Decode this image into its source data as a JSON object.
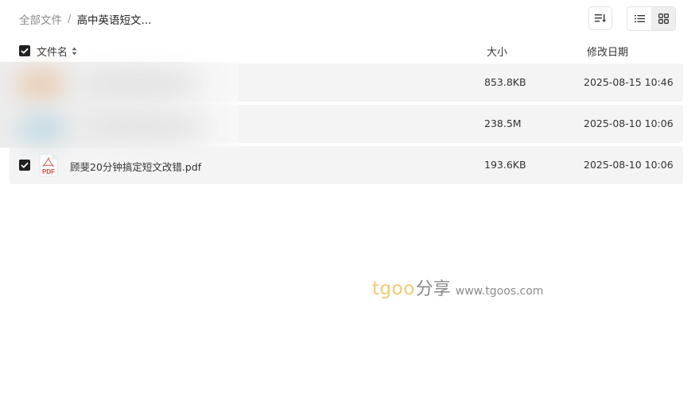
{
  "breadcrumb": {
    "root": "全部文件",
    "separator": "/",
    "current": "高中英语短文..."
  },
  "toolbar": {
    "sort_icon": "sort-list-icon",
    "view_list_icon": "list-view-icon",
    "view_grid_icon": "grid-view-icon",
    "active_view": "list"
  },
  "table": {
    "header": {
      "name": "文件名",
      "size": "大小",
      "date": "修改日期",
      "select_all_checked": true
    },
    "rows": [
      {
        "name": "",
        "size": "853.8KB",
        "date": "2025-08-15 10:46",
        "checked": false,
        "blurred": true
      },
      {
        "name": "",
        "size": "238.5M",
        "date": "2025-08-10 10:06",
        "checked": false,
        "blurred": true
      },
      {
        "name": "顾斐20分钟搞定短文改错.pdf",
        "size": "193.6KB",
        "date": "2025-08-10 10:06",
        "checked": true,
        "icon": "pdf-file-icon",
        "icon_label": "PDF"
      }
    ]
  },
  "watermark": {
    "brand": "tgoo",
    "share": "分享",
    "url": "www.tgoos.com"
  },
  "colors": {
    "row_bg": "#f4f4f4",
    "checkbox": "#1e1e1e",
    "pdf_red": "#e5443a",
    "watermark_brand": "#f2c15a"
  }
}
